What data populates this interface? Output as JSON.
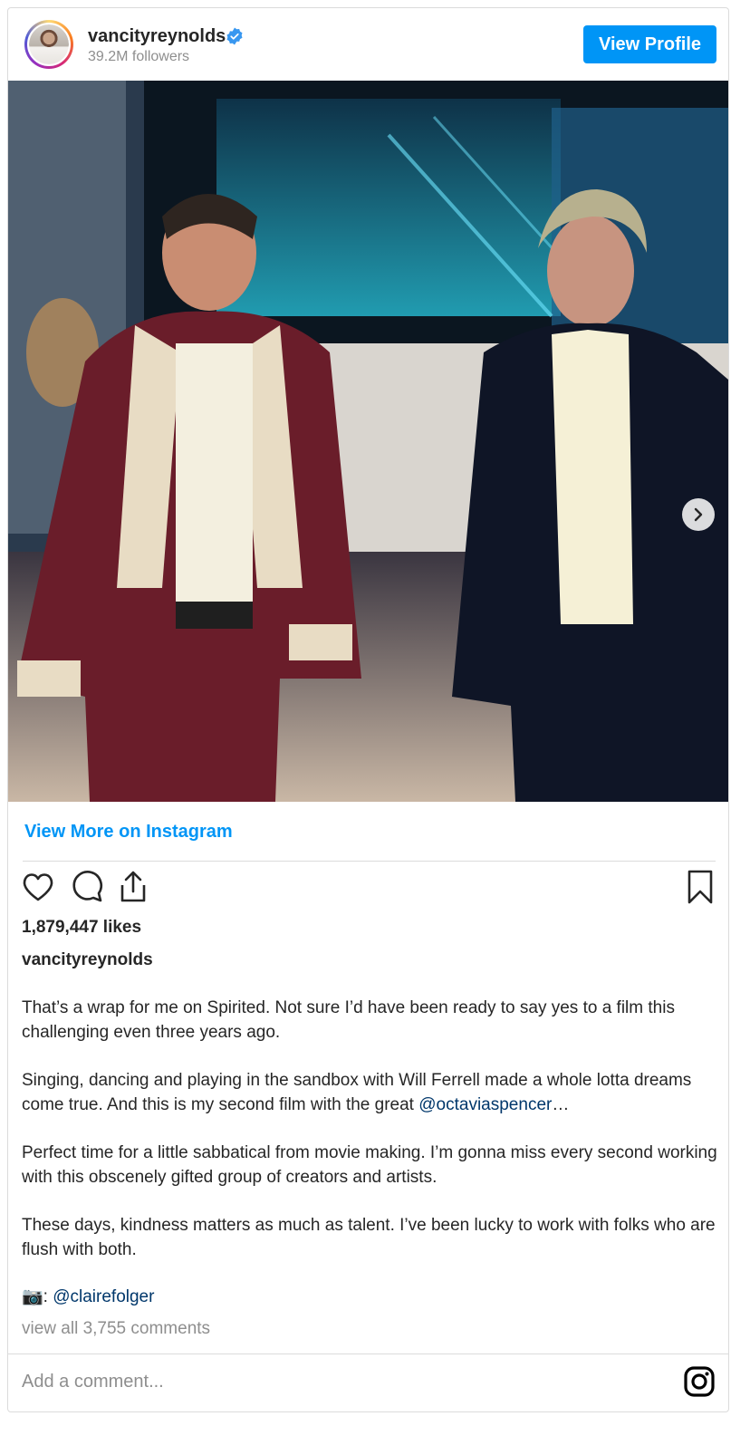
{
  "header": {
    "username": "vancityreynolds",
    "followers": "39.2M followers",
    "view_profile_label": "View Profile"
  },
  "actions": {
    "view_more_label": "View More on Instagram",
    "likes": "1,879,447 likes"
  },
  "caption": {
    "username": "vancityreynolds",
    "paragraph1": "That’s a wrap for me on Spirited. Not sure I’d have been ready to say yes to a film this challenging even three years ago.",
    "paragraph2_text": "Singing, dancing and playing in the sandbox with Will Ferrell made a whole lotta dreams come true. And this is my second film with the great ",
    "paragraph2_mention": "@octaviaspencer",
    "paragraph2_suffix": "…",
    "paragraph3": "Perfect time for a little sabbatical from movie making. I’m gonna miss every second working with this obscenely gifted group of creators and artists.",
    "paragraph4": "These days, kindness matters as much as talent. I’ve been lucky to work with folks who are flush with both.",
    "credit_emoji": "📷",
    "credit_sep": ": ",
    "credit_mention": "@clairefolger"
  },
  "comments": {
    "view_all": "view all 3,755 comments",
    "add_placeholder": "Add a comment..."
  },
  "icons": [
    "verified-badge-icon",
    "chevron-right-icon",
    "heart-icon",
    "comment-icon",
    "share-icon",
    "bookmark-icon",
    "instagram-logo-icon"
  ],
  "colors": {
    "accent": "#0095f6",
    "mention": "#00376b",
    "muted": "#8e8e8e",
    "text": "#262626"
  }
}
